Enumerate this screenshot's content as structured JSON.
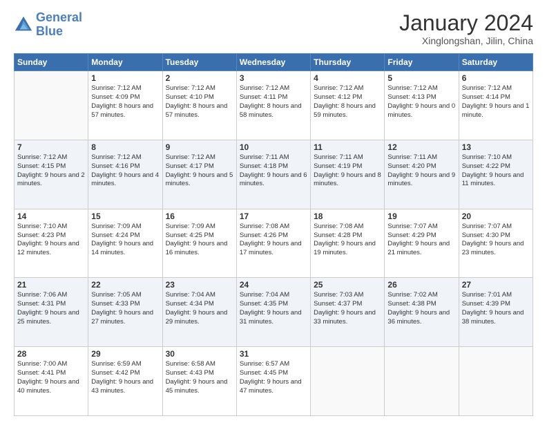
{
  "header": {
    "logo_line1": "General",
    "logo_line2": "Blue",
    "title": "January 2024",
    "subtitle": "Xinglongshan, Jilin, China"
  },
  "weekdays": [
    "Sunday",
    "Monday",
    "Tuesday",
    "Wednesday",
    "Thursday",
    "Friday",
    "Saturday"
  ],
  "weeks": [
    [
      {
        "day": "",
        "sunrise": "",
        "sunset": "",
        "daylight": ""
      },
      {
        "day": "1",
        "sunrise": "Sunrise: 7:12 AM",
        "sunset": "Sunset: 4:09 PM",
        "daylight": "Daylight: 8 hours and 57 minutes."
      },
      {
        "day": "2",
        "sunrise": "Sunrise: 7:12 AM",
        "sunset": "Sunset: 4:10 PM",
        "daylight": "Daylight: 8 hours and 57 minutes."
      },
      {
        "day": "3",
        "sunrise": "Sunrise: 7:12 AM",
        "sunset": "Sunset: 4:11 PM",
        "daylight": "Daylight: 8 hours and 58 minutes."
      },
      {
        "day": "4",
        "sunrise": "Sunrise: 7:12 AM",
        "sunset": "Sunset: 4:12 PM",
        "daylight": "Daylight: 8 hours and 59 minutes."
      },
      {
        "day": "5",
        "sunrise": "Sunrise: 7:12 AM",
        "sunset": "Sunset: 4:13 PM",
        "daylight": "Daylight: 9 hours and 0 minutes."
      },
      {
        "day": "6",
        "sunrise": "Sunrise: 7:12 AM",
        "sunset": "Sunset: 4:14 PM",
        "daylight": "Daylight: 9 hours and 1 minute."
      }
    ],
    [
      {
        "day": "7",
        "sunrise": "Sunrise: 7:12 AM",
        "sunset": "Sunset: 4:15 PM",
        "daylight": "Daylight: 9 hours and 2 minutes."
      },
      {
        "day": "8",
        "sunrise": "Sunrise: 7:12 AM",
        "sunset": "Sunset: 4:16 PM",
        "daylight": "Daylight: 9 hours and 4 minutes."
      },
      {
        "day": "9",
        "sunrise": "Sunrise: 7:12 AM",
        "sunset": "Sunset: 4:17 PM",
        "daylight": "Daylight: 9 hours and 5 minutes."
      },
      {
        "day": "10",
        "sunrise": "Sunrise: 7:11 AM",
        "sunset": "Sunset: 4:18 PM",
        "daylight": "Daylight: 9 hours and 6 minutes."
      },
      {
        "day": "11",
        "sunrise": "Sunrise: 7:11 AM",
        "sunset": "Sunset: 4:19 PM",
        "daylight": "Daylight: 9 hours and 8 minutes."
      },
      {
        "day": "12",
        "sunrise": "Sunrise: 7:11 AM",
        "sunset": "Sunset: 4:20 PM",
        "daylight": "Daylight: 9 hours and 9 minutes."
      },
      {
        "day": "13",
        "sunrise": "Sunrise: 7:10 AM",
        "sunset": "Sunset: 4:22 PM",
        "daylight": "Daylight: 9 hours and 11 minutes."
      }
    ],
    [
      {
        "day": "14",
        "sunrise": "Sunrise: 7:10 AM",
        "sunset": "Sunset: 4:23 PM",
        "daylight": "Daylight: 9 hours and 12 minutes."
      },
      {
        "day": "15",
        "sunrise": "Sunrise: 7:09 AM",
        "sunset": "Sunset: 4:24 PM",
        "daylight": "Daylight: 9 hours and 14 minutes."
      },
      {
        "day": "16",
        "sunrise": "Sunrise: 7:09 AM",
        "sunset": "Sunset: 4:25 PM",
        "daylight": "Daylight: 9 hours and 16 minutes."
      },
      {
        "day": "17",
        "sunrise": "Sunrise: 7:08 AM",
        "sunset": "Sunset: 4:26 PM",
        "daylight": "Daylight: 9 hours and 17 minutes."
      },
      {
        "day": "18",
        "sunrise": "Sunrise: 7:08 AM",
        "sunset": "Sunset: 4:28 PM",
        "daylight": "Daylight: 9 hours and 19 minutes."
      },
      {
        "day": "19",
        "sunrise": "Sunrise: 7:07 AM",
        "sunset": "Sunset: 4:29 PM",
        "daylight": "Daylight: 9 hours and 21 minutes."
      },
      {
        "day": "20",
        "sunrise": "Sunrise: 7:07 AM",
        "sunset": "Sunset: 4:30 PM",
        "daylight": "Daylight: 9 hours and 23 minutes."
      }
    ],
    [
      {
        "day": "21",
        "sunrise": "Sunrise: 7:06 AM",
        "sunset": "Sunset: 4:31 PM",
        "daylight": "Daylight: 9 hours and 25 minutes."
      },
      {
        "day": "22",
        "sunrise": "Sunrise: 7:05 AM",
        "sunset": "Sunset: 4:33 PM",
        "daylight": "Daylight: 9 hours and 27 minutes."
      },
      {
        "day": "23",
        "sunrise": "Sunrise: 7:04 AM",
        "sunset": "Sunset: 4:34 PM",
        "daylight": "Daylight: 9 hours and 29 minutes."
      },
      {
        "day": "24",
        "sunrise": "Sunrise: 7:04 AM",
        "sunset": "Sunset: 4:35 PM",
        "daylight": "Daylight: 9 hours and 31 minutes."
      },
      {
        "day": "25",
        "sunrise": "Sunrise: 7:03 AM",
        "sunset": "Sunset: 4:37 PM",
        "daylight": "Daylight: 9 hours and 33 minutes."
      },
      {
        "day": "26",
        "sunrise": "Sunrise: 7:02 AM",
        "sunset": "Sunset: 4:38 PM",
        "daylight": "Daylight: 9 hours and 36 minutes."
      },
      {
        "day": "27",
        "sunrise": "Sunrise: 7:01 AM",
        "sunset": "Sunset: 4:39 PM",
        "daylight": "Daylight: 9 hours and 38 minutes."
      }
    ],
    [
      {
        "day": "28",
        "sunrise": "Sunrise: 7:00 AM",
        "sunset": "Sunset: 4:41 PM",
        "daylight": "Daylight: 9 hours and 40 minutes."
      },
      {
        "day": "29",
        "sunrise": "Sunrise: 6:59 AM",
        "sunset": "Sunset: 4:42 PM",
        "daylight": "Daylight: 9 hours and 43 minutes."
      },
      {
        "day": "30",
        "sunrise": "Sunrise: 6:58 AM",
        "sunset": "Sunset: 4:43 PM",
        "daylight": "Daylight: 9 hours and 45 minutes."
      },
      {
        "day": "31",
        "sunrise": "Sunrise: 6:57 AM",
        "sunset": "Sunset: 4:45 PM",
        "daylight": "Daylight: 9 hours and 47 minutes."
      },
      {
        "day": "",
        "sunrise": "",
        "sunset": "",
        "daylight": ""
      },
      {
        "day": "",
        "sunrise": "",
        "sunset": "",
        "daylight": ""
      },
      {
        "day": "",
        "sunrise": "",
        "sunset": "",
        "daylight": ""
      }
    ]
  ]
}
